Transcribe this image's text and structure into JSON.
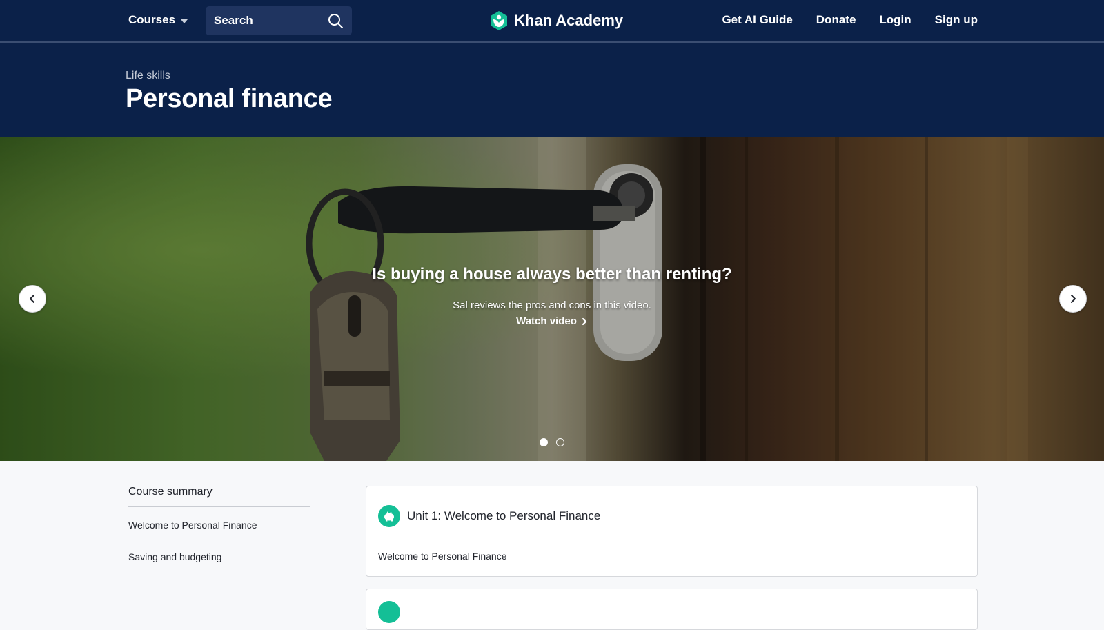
{
  "nav": {
    "courses_label": "Courses",
    "search_placeholder": "Search",
    "brand": "Khan Academy",
    "links": [
      "Get AI Guide",
      "Donate",
      "Login",
      "Sign up"
    ]
  },
  "header": {
    "subject": "Life skills",
    "title": "Personal finance"
  },
  "hero": {
    "headline": "Is buying a house always better than renting?",
    "description": "Sal reviews the pros and cons in this video.",
    "link_label": "Watch video",
    "slide_count": 2,
    "active_slide": 1
  },
  "summary": {
    "title": "Course summary",
    "items": [
      "Welcome to Personal Finance",
      "Saving and budgeting"
    ]
  },
  "units": [
    {
      "title": "Unit 1: Welcome to Personal Finance",
      "lessons": [
        "Welcome to Personal Finance"
      ]
    }
  ],
  "colors": {
    "navy": "#0b2149",
    "accent_green": "#14bf96",
    "background": "#f7f8fa"
  },
  "icons": {
    "search": "search-icon",
    "logo": "khan-academy-logo-icon",
    "prev": "chevron-left-icon",
    "next": "chevron-right-icon",
    "unit": "piggy-bank-icon"
  }
}
